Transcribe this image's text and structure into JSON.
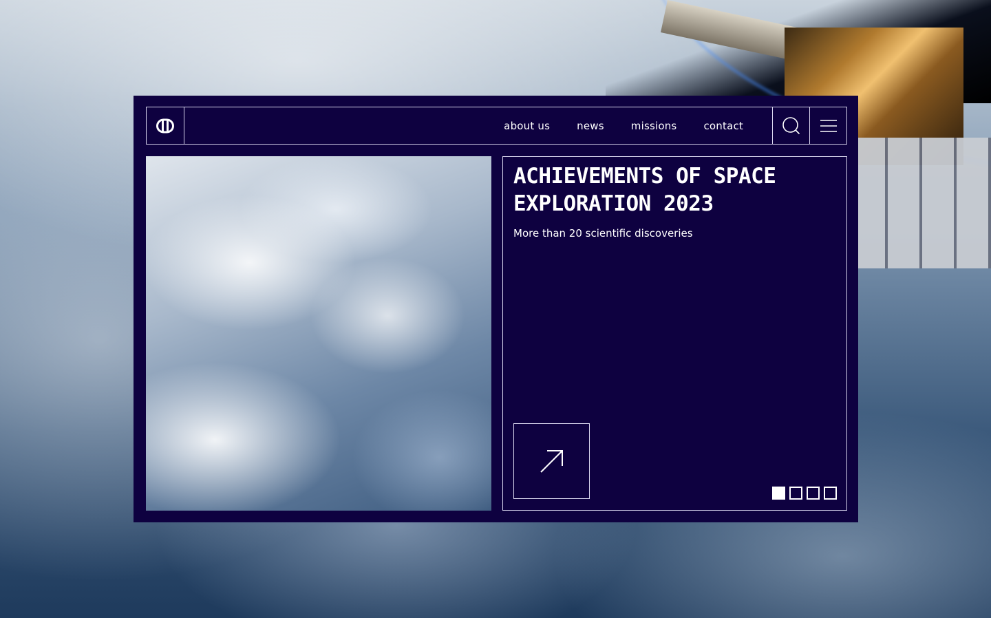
{
  "nav": {
    "links": [
      "about us",
      "news",
      "missions",
      "contact"
    ]
  },
  "hero": {
    "title": "ACHIEVEMENTS OF SPACE EXPLORATION 2023",
    "subtitle": "More than 20 scientific discoveries"
  },
  "pager": {
    "total": 4,
    "active_index": 0
  },
  "colors": {
    "panel": "#0e0140",
    "border": "#d9d6ee",
    "text": "#ffffff"
  },
  "icons": [
    "logo-icon",
    "search-icon",
    "menu-icon",
    "arrow-up-right-icon"
  ]
}
